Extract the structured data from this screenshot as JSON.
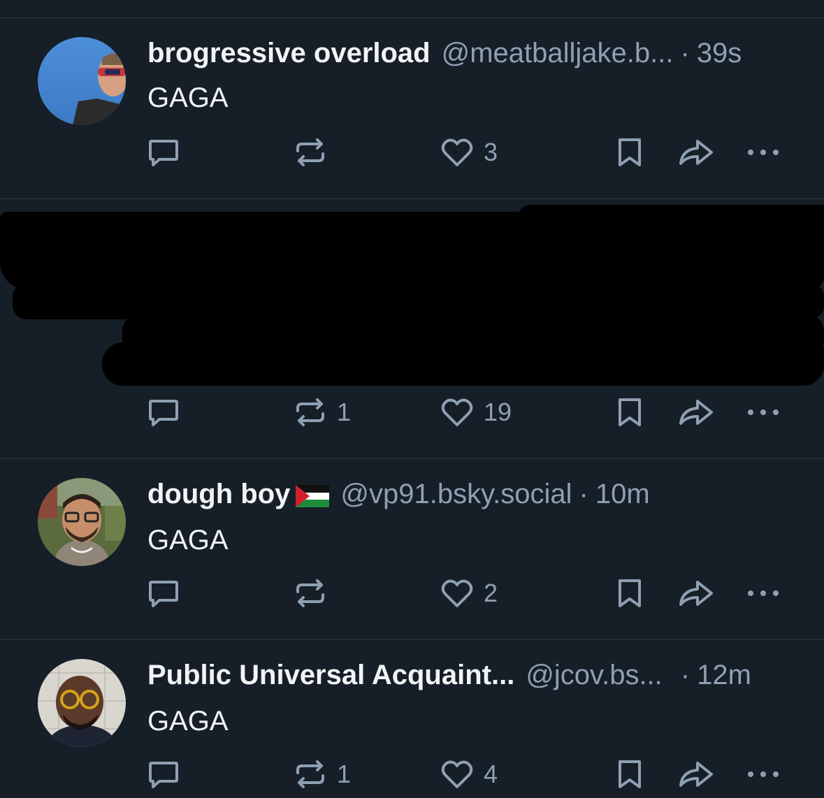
{
  "posts": [
    {
      "name": "brogressive overload",
      "handle": "@meatballjake.b...",
      "dot": "·",
      "time": "39s",
      "text": "GAGA",
      "avatar_icon": "profile-photo-sunglasses",
      "reposts": "",
      "likes": "3"
    },
    {
      "name": "",
      "handle": "",
      "time": "",
      "text": "",
      "redacted": true,
      "reposts": "1",
      "likes": "19"
    },
    {
      "name": "dough boy",
      "flag_icon": "palestine-flag-emoji",
      "handle": "@vp91.bsky.social",
      "dot": "·",
      "time": "10m",
      "text": "GAGA",
      "avatar_icon": "profile-photo-glasses-beard",
      "reposts": "",
      "likes": "2"
    },
    {
      "name": "Public Universal Acquaint...",
      "handle": "@jcov.bs...",
      "dot": "·",
      "time": "12m",
      "text": "GAGA",
      "avatar_icon": "profile-photo-round-glasses",
      "reposts": "1",
      "likes": "4"
    }
  ],
  "colors": {
    "background": "#161e27",
    "divider": "#2e3a47",
    "muted": "#8fa0b3",
    "text": "#f1f3f5"
  },
  "icons": [
    "reply-icon",
    "repost-icon",
    "like-icon",
    "bookmark-icon",
    "share-icon",
    "more-icon"
  ]
}
